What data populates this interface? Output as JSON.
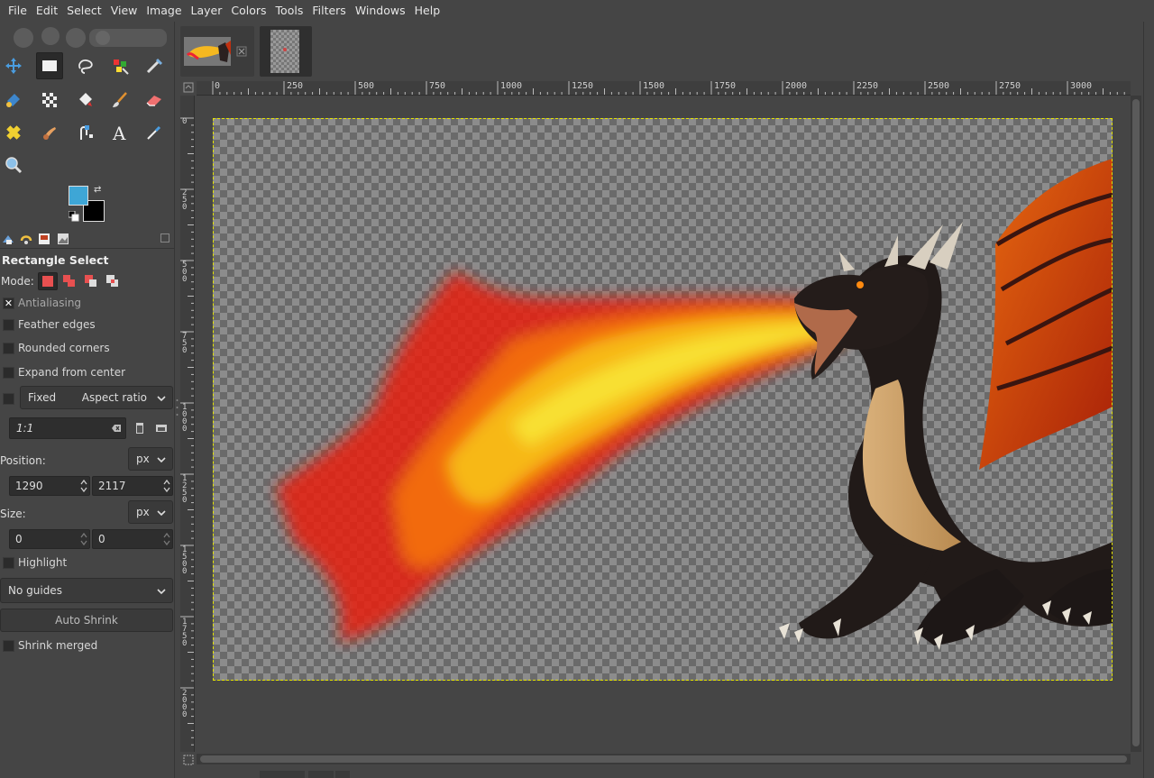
{
  "menubar": {
    "items": [
      "File",
      "Edit",
      "Select",
      "View",
      "Image",
      "Layer",
      "Colors",
      "Tools",
      "Filters",
      "Windows",
      "Help"
    ]
  },
  "toolbox": {
    "tools": [
      {
        "icon": "move-tool-icon"
      },
      {
        "icon": "rectangle-select-icon",
        "active": true
      },
      {
        "icon": "free-select-icon"
      },
      {
        "icon": "foreground-select-icon"
      },
      {
        "icon": "crop-icon"
      },
      {
        "icon": "unified-transform-icon"
      },
      {
        "icon": "warp-transform-icon"
      },
      {
        "icon": "bucket-fill-icon"
      },
      {
        "icon": "paintbrush-icon"
      },
      {
        "icon": "eraser-icon"
      },
      {
        "icon": "heal-icon"
      },
      {
        "icon": "smudge-icon"
      },
      {
        "icon": "paths-icon"
      },
      {
        "icon": "text-tool-icon"
      },
      {
        "icon": "color-picker-icon"
      },
      {
        "icon": "zoom-icon"
      }
    ],
    "foreground_color": "#3ea6d6",
    "background_color": "#000000"
  },
  "tool_options": {
    "title": "Rectangle Select",
    "mode_label": "Mode:",
    "antialiasing": {
      "label": "Antialiasing",
      "checked": true
    },
    "feather_edges": {
      "label": "Feather edges",
      "checked": false
    },
    "rounded_corners": {
      "label": "Rounded corners",
      "checked": false
    },
    "expand_from_center": {
      "label": "Expand from center",
      "checked": false
    },
    "fixed": {
      "label": "Fixed",
      "checked": false,
      "option": "Aspect ratio"
    },
    "ratio_value": "1:1",
    "position_label": "Position:",
    "position_unit": "px",
    "position_x": "1290",
    "position_y": "2117",
    "size_label": "Size:",
    "size_unit": "px",
    "size_w": "0",
    "size_h": "0",
    "highlight": {
      "label": "Highlight",
      "checked": false
    },
    "guides": "No guides",
    "auto_shrink": "Auto Shrink",
    "shrink_merged": {
      "label": "Shrink merged",
      "checked": false
    }
  },
  "ruler": {
    "top_labels": [
      "0",
      "250",
      "500",
      "750",
      "1000",
      "1250",
      "1500",
      "1750",
      "2000",
      "2250",
      "2500",
      "2750",
      "3000"
    ],
    "left_labels": [
      "0",
      "250",
      "500",
      "750",
      "1000",
      "1250",
      "1500",
      "1750",
      "2000"
    ]
  }
}
